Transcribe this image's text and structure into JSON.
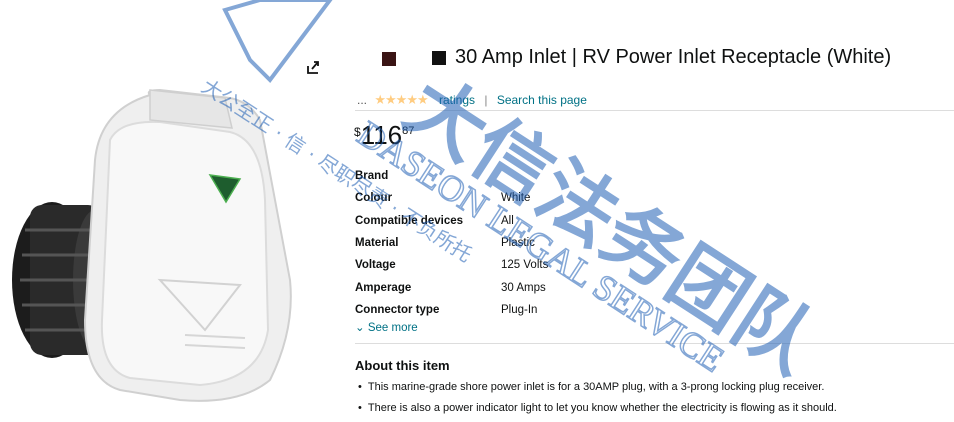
{
  "product": {
    "title": "30 Amp Inlet | RV Power Inlet Receptacle (White)",
    "ratings_dots": "...",
    "ratings_text": "ratings",
    "search_link": "Search this page",
    "rating_sep": "|",
    "price_currency": "$",
    "price_whole": "116",
    "price_fraction": "87",
    "specs": [
      {
        "key": "Brand",
        "value": ""
      },
      {
        "key": "Colour",
        "value": "White"
      },
      {
        "key": "Compatible devices",
        "value": "All"
      },
      {
        "key": "Material",
        "value": "Plastic"
      },
      {
        "key": "Voltage",
        "value": "125 Volts"
      },
      {
        "key": "Amperage",
        "value": "30 Amps"
      },
      {
        "key": "Connector type",
        "value": "Plug-In"
      }
    ],
    "see_more": "See more",
    "about_title": "About this item",
    "bullets": [
      "This marine-grade shore power inlet is for a 30AMP plug, with a 3-prong locking plug receiver.",
      "There is also a power indicator light to let you know whether the electricity is flowing as it should."
    ]
  },
  "colors": {
    "swatch_dark": "#3a1414",
    "link": "#007185",
    "star": "#ffa41c",
    "watermark": "#1f5fb4"
  },
  "watermark": {
    "chinese_big": "大信法务团队",
    "chinese_small": "大公至正 · 信 · 尽职尽责 · 不负所托",
    "english": "DASEON LEGAL SERVICE"
  }
}
